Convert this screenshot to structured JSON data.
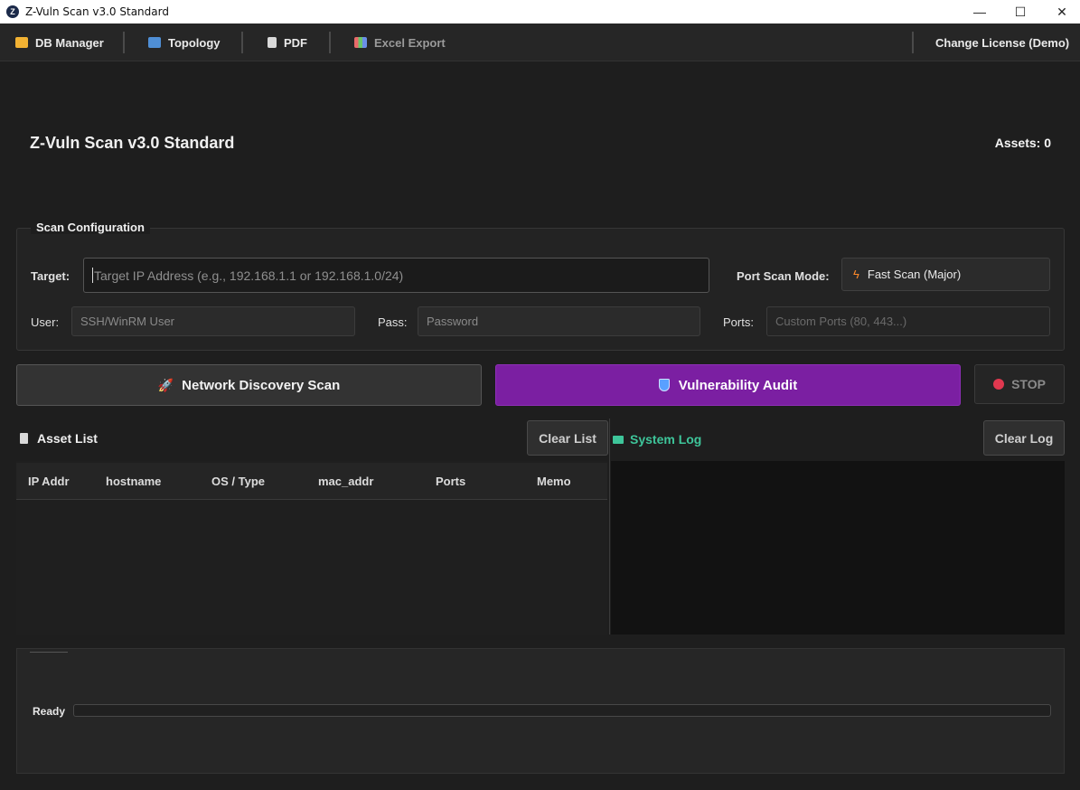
{
  "window": {
    "title": "Z-Vuln Scan v3.0 Standard",
    "icon_letter": "Z"
  },
  "window_controls": {
    "minimize": "—",
    "maximize": "☐",
    "close": "✕"
  },
  "toolbar": {
    "db_manager": "DB Manager",
    "topology": "Topology",
    "pdf": "PDF",
    "excel_export": "Excel Export",
    "change_license": "Change License (Demo)"
  },
  "header": {
    "app_title": "Z-Vuln Scan v3.0 Standard",
    "assets": "Assets: 0"
  },
  "scan_config": {
    "legend": "Scan Configuration",
    "target_label": "Target:",
    "target_placeholder": "Target IP Address (e.g., 192.168.1.1 or 192.168.1.0/24)",
    "port_mode_label": "Port Scan Mode:",
    "port_mode_value": "Fast Scan (Major)",
    "user_label": "User:",
    "user_placeholder": "SSH/WinRM User",
    "pass_label": "Pass:",
    "pass_placeholder": "Password",
    "ports_label": "Ports:",
    "ports_placeholder": "Custom Ports (80, 443...)"
  },
  "actions": {
    "discovery": "Network Discovery Scan",
    "audit": "Vulnerability Audit",
    "stop": "STOP"
  },
  "asset_list": {
    "title": "Asset List",
    "clear_button": "Clear List",
    "columns": [
      "IP Addr",
      "hostname",
      "OS / Type",
      "mac_addr",
      "Ports",
      "Memo"
    ]
  },
  "system_log": {
    "title": "System Log",
    "clear_button": "Clear Log"
  },
  "status": {
    "text": "Ready",
    "progress": 0
  },
  "colors": {
    "accent_purple": "#7b1fa2",
    "log_title": "#3ec59a",
    "stop_dot": "#e0384f",
    "background": "#1e1e1e"
  }
}
